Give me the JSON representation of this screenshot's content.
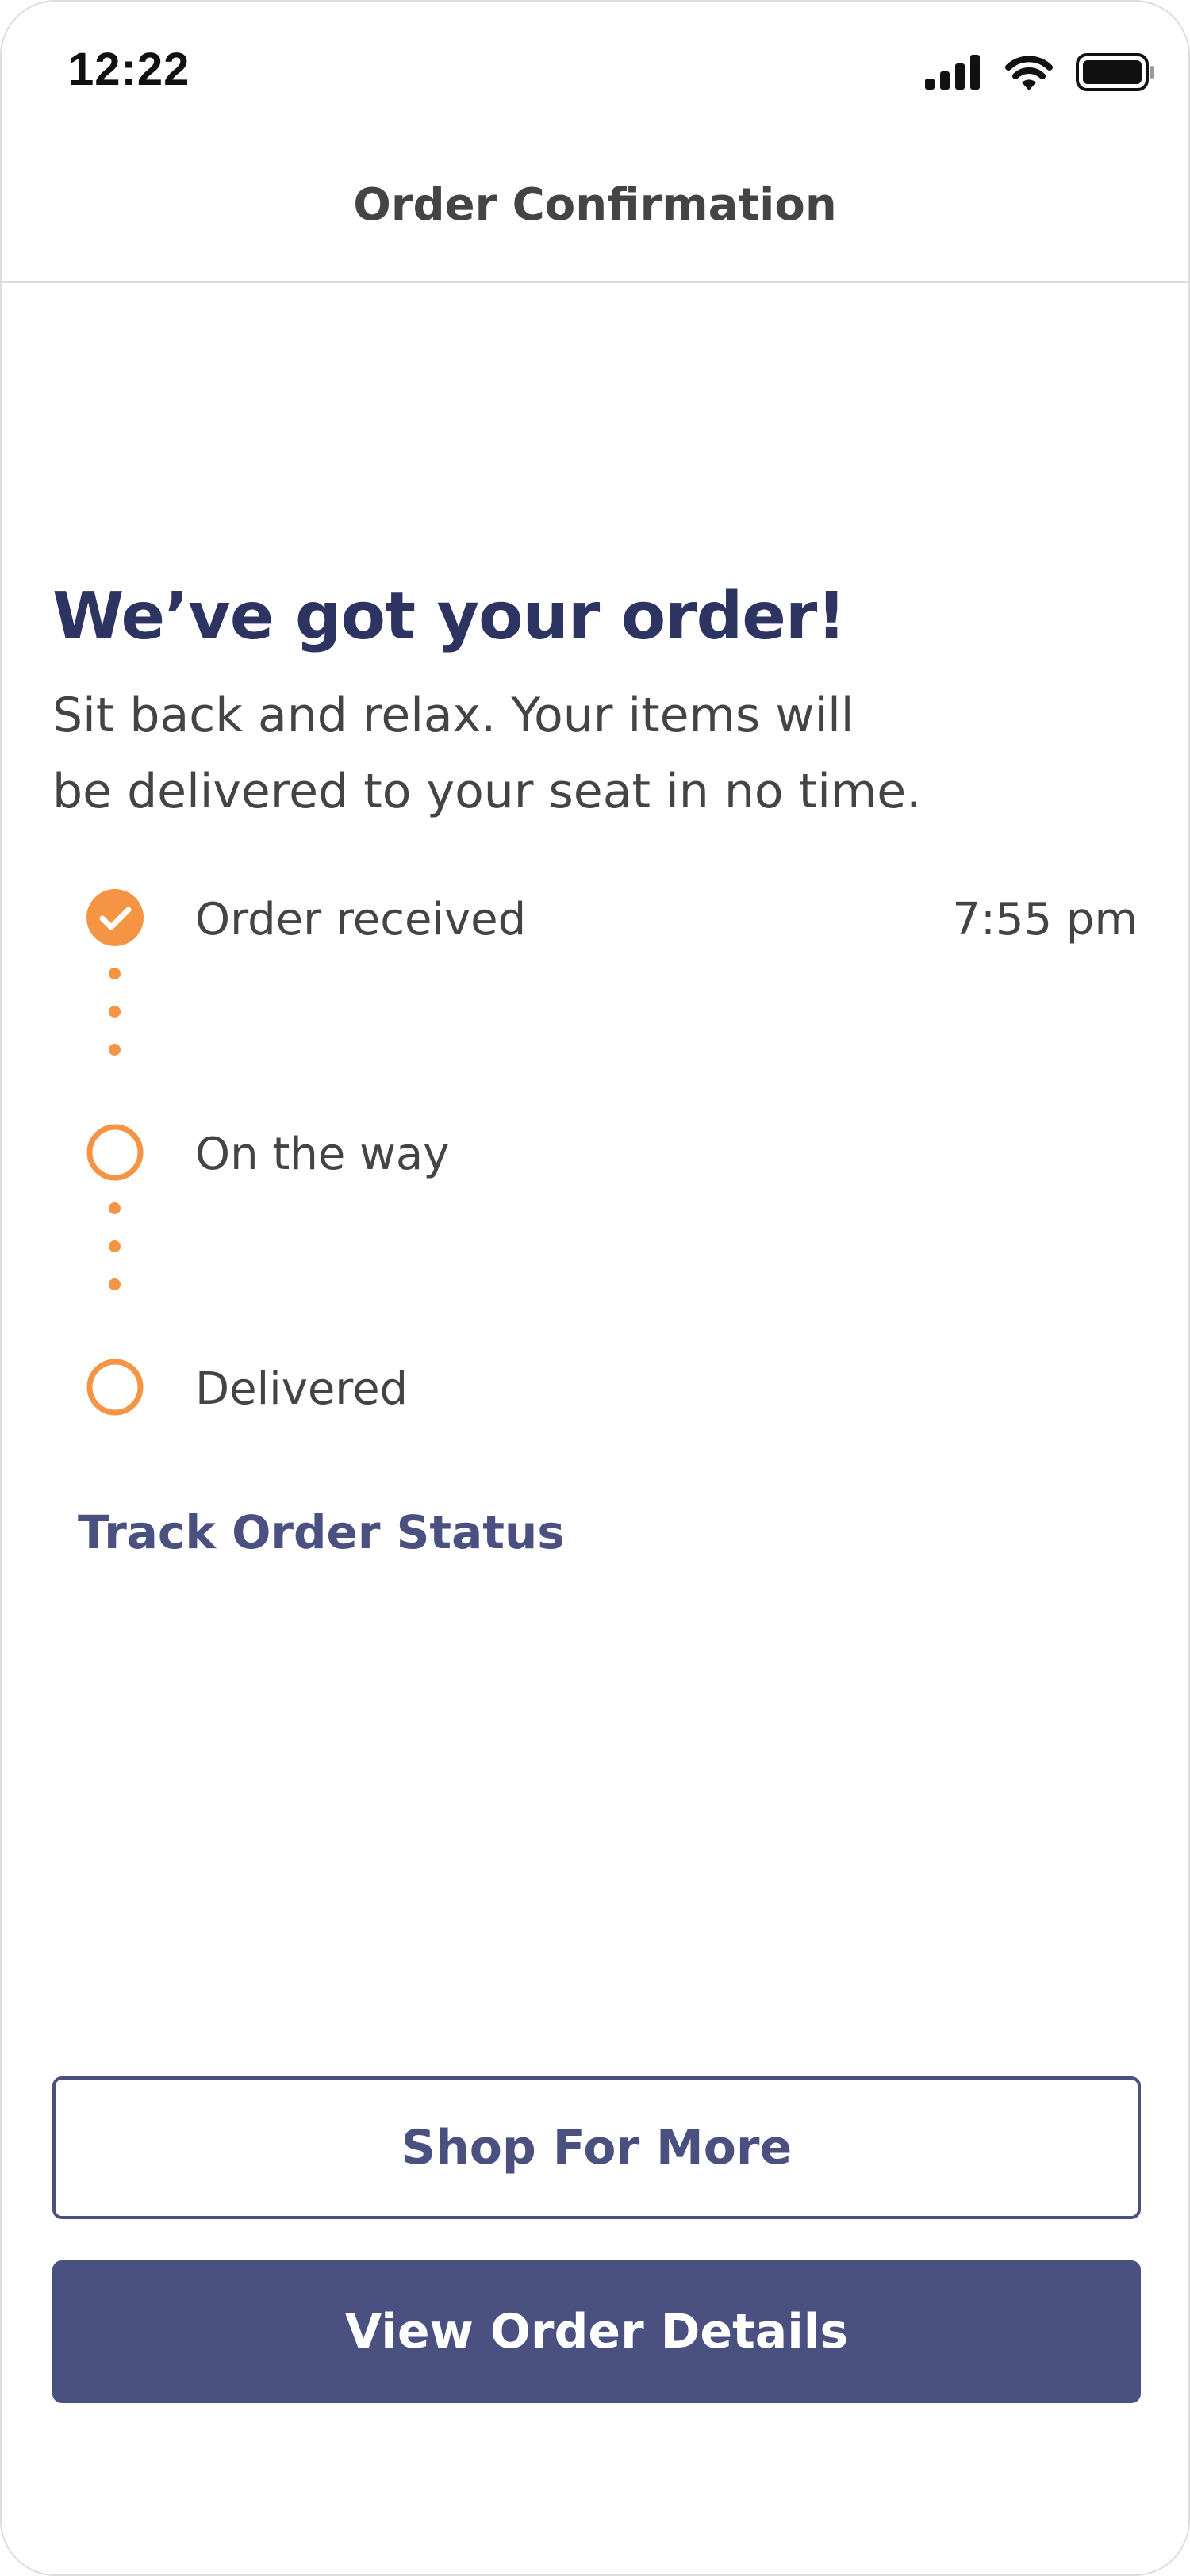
{
  "status_bar": {
    "time": "12:22",
    "icons": [
      "cellular-signal-icon",
      "wifi-icon",
      "battery-icon"
    ]
  },
  "header": {
    "title": "Order Confirmation"
  },
  "confirmation": {
    "headline": "We’ve got your order!",
    "subtext_line1": "Sit back and relax. Your items will",
    "subtext_line2": "be delivered to your seat in no time."
  },
  "timeline": {
    "steps": [
      {
        "label": "Order received",
        "time": "7:55 pm",
        "completed": true
      },
      {
        "label": "On the way",
        "time": "",
        "completed": false
      },
      {
        "label": "Delivered",
        "time": "",
        "completed": false
      }
    ],
    "track_link": "Track Order Status"
  },
  "actions": {
    "shop_more": "Shop For More",
    "view_details": "View Order Details"
  },
  "colors": {
    "accent_orange": "#f59442",
    "brand_navy": "#2d3462",
    "button_navy": "#4a5080",
    "text_gray": "#444444"
  }
}
